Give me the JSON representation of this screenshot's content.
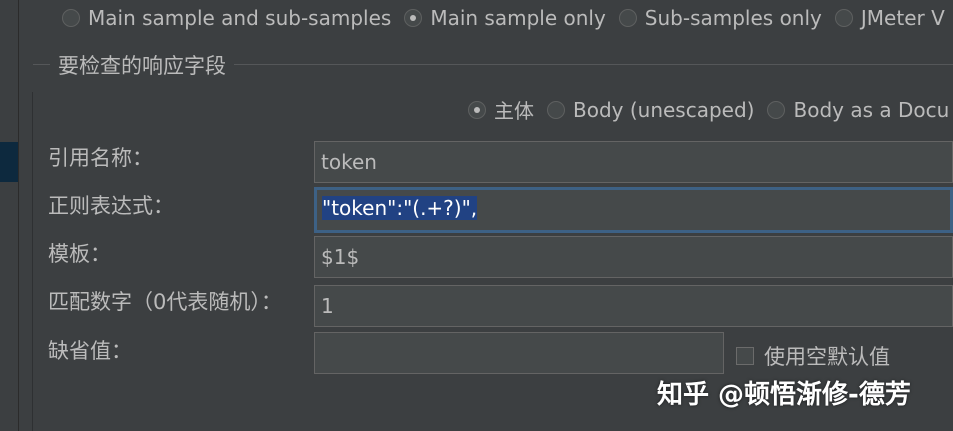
{
  "sample_scope": {
    "options": [
      {
        "label": "Main sample and sub-samples",
        "selected": false
      },
      {
        "label": "Main sample only",
        "selected": true
      },
      {
        "label": "Sub-samples only",
        "selected": false
      },
      {
        "label": "JMeter V",
        "selected": false
      }
    ]
  },
  "response_field": {
    "title": "要检查的响应字段",
    "options": [
      {
        "label": "主体",
        "selected": true
      },
      {
        "label": "Body (unescaped)",
        "selected": false
      },
      {
        "label": "Body as a Docu",
        "selected": false
      }
    ]
  },
  "form": {
    "reference_name": {
      "label": "引用名称：",
      "value": "token"
    },
    "regex": {
      "label": "正则表达式：",
      "value": "\"token\":\"(.+?)\","
    },
    "template": {
      "label": "模板：",
      "value": "$1$"
    },
    "match_no": {
      "label": "匹配数字（0代表随机）：",
      "value": "1"
    },
    "default_value": {
      "label": "缺省值：",
      "value": ""
    },
    "use_empty_default": {
      "label": "使用空默认值",
      "checked": false
    }
  },
  "watermark": {
    "text": "知乎 @顿悟渐修-德芳"
  }
}
